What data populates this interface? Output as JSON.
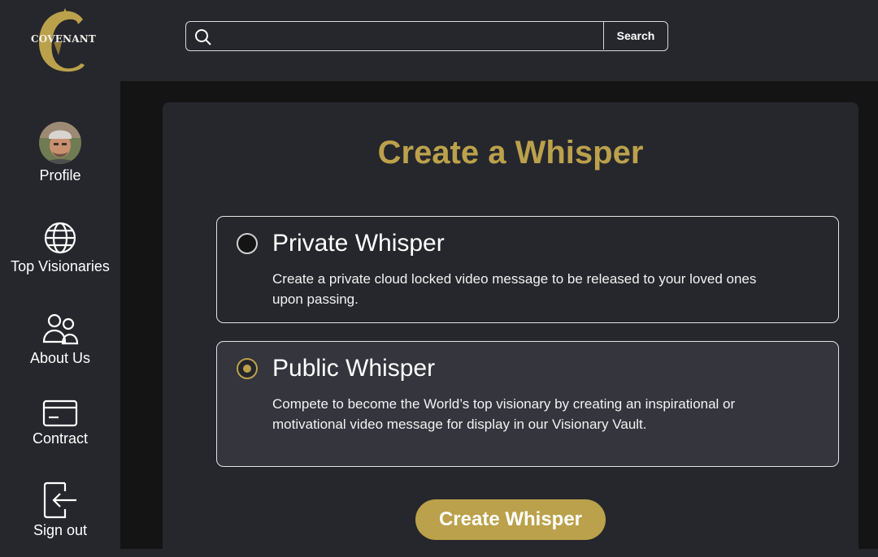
{
  "brand": {
    "logo_text": "COVENANT",
    "accent": "#bba14b"
  },
  "sidebar": {
    "items": [
      {
        "label": "Profile",
        "icon": "avatar"
      },
      {
        "label": "Top Visionaries",
        "icon": "globe-icon"
      },
      {
        "label": "About Us",
        "icon": "users-icon"
      },
      {
        "label": "Contract",
        "icon": "card-icon"
      },
      {
        "label": "Sign out",
        "icon": "sign-out-icon"
      }
    ]
  },
  "search": {
    "placeholder": "",
    "button_label": "Search"
  },
  "main": {
    "title": "Create a Whisper",
    "options": [
      {
        "title": "Private Whisper",
        "description": "Create a private cloud locked video message to be released to your loved ones upon passing.",
        "selected": false
      },
      {
        "title": "Public Whisper",
        "description": "Compete to become the World’s top visionary by creating an inspirational or motivational video message for display in our Visionary Vault.",
        "selected": true
      }
    ],
    "submit_label": "Create Whisper"
  }
}
